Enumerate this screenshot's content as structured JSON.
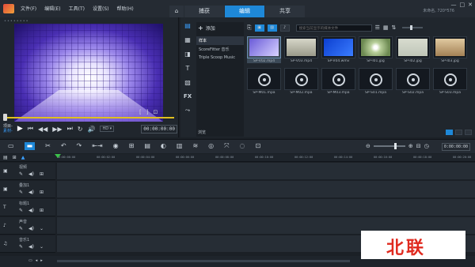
{
  "titlebar": {
    "menu": [
      "文件(F)",
      "编辑(E)",
      "工具(T)",
      "设置(S)",
      "帮助(H)"
    ],
    "steps": [
      {
        "label": "⌂",
        "icon": "home-icon"
      },
      {
        "label": "捕获"
      },
      {
        "label": "编辑",
        "active": true
      },
      {
        "label": "共享"
      }
    ],
    "project_info": "未命名, 720*576",
    "window_controls": [
      "—",
      "□",
      "✕"
    ]
  },
  "player": {
    "mode_project": "项目-",
    "mode_clip": "素材-",
    "zoom": "HD ▾",
    "timecode": "00:00:00:00",
    "markers": [
      "[",
      "]",
      "⊡"
    ]
  },
  "library": {
    "add_label": "添加",
    "folders": [
      "样本",
      "ScoreFitter 音乐",
      "Triple Scoop Music"
    ],
    "browse_label": "浏览",
    "search_placeholder": "搜索当前显示的媒体文件",
    "items": [
      {
        "name": "SP-V02.mp4",
        "kind": "video",
        "selected": true
      },
      {
        "name": "SP-V03.mp4",
        "kind": "gray"
      },
      {
        "name": "SP-V04.wmv",
        "kind": "blue"
      },
      {
        "name": "SP-I01.jpg",
        "kind": "dandelion"
      },
      {
        "name": "SP-I02.jpg",
        "kind": "tree"
      },
      {
        "name": "SP-I03.jpg",
        "kind": "autumn"
      },
      {
        "name": "SP-M01.mpa",
        "kind": "audio"
      },
      {
        "name": "SP-M02.mpa",
        "kind": "audio"
      },
      {
        "name": "SP-M03.mpa",
        "kind": "audio"
      },
      {
        "name": "SP-S01.mpa",
        "kind": "audio"
      },
      {
        "name": "SP-S02.mpa",
        "kind": "audio"
      },
      {
        "name": "SP-S03.mpa",
        "kind": "audio"
      }
    ]
  },
  "timeline": {
    "timecode": "0:00:00:00",
    "ruler_ticks": [
      "00:00:00:00",
      "00:00:02:00",
      "00:00:04:00",
      "00:00:06:00",
      "00:00:08:00",
      "00:00:10:00",
      "00:00:12:00",
      "00:00:14:00",
      "00:00:16:00",
      "00:00:18:00",
      "00:00:20:00"
    ],
    "tracks": [
      {
        "name": "视频",
        "icon": "video-track-icon",
        "glyph": "▣"
      },
      {
        "name": "叠加1",
        "icon": "overlay-track-icon",
        "glyph": "▣"
      },
      {
        "name": "标题1",
        "icon": "title-track-icon",
        "glyph": "T"
      },
      {
        "name": "声音",
        "icon": "voice-track-icon",
        "glyph": "♪"
      },
      {
        "name": "音乐1",
        "icon": "music-track-icon",
        "glyph": "♫"
      }
    ]
  },
  "watermark": "北联"
}
